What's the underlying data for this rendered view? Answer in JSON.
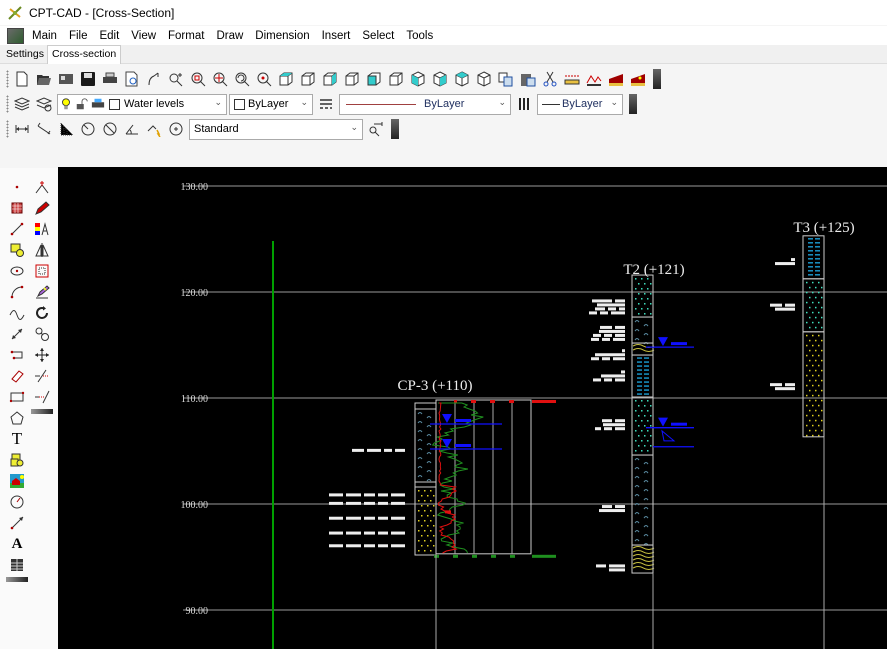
{
  "window": {
    "title": "CPT-CAD - [Cross-Section]",
    "app_icon": "cptcad-logo-icon"
  },
  "menubar": {
    "items": [
      "Main",
      "File",
      "Edit",
      "View",
      "Format",
      "Draw",
      "Dimension",
      "Insert",
      "Select",
      "Tools"
    ]
  },
  "tabs": [
    {
      "label": "Settings",
      "active": false
    },
    {
      "label": "Cross-section",
      "active": true
    }
  ],
  "toolbar_standard": {
    "icons": [
      "new-icon",
      "open-icon",
      "import-icon",
      "save-icon",
      "print-icon",
      "print-preview-icon",
      "pan-realtime-icon",
      "zoom-realtime-icon",
      "zoom-window-icon",
      "zoom-pan-icon",
      "zoom-previous-icon",
      "zoom-center-icon",
      "view-top-icon",
      "view-bottom-icon",
      "view-left-icon",
      "view-right-icon",
      "view-front-icon",
      "view-back-icon",
      "iso-sw-icon",
      "iso-se-icon",
      "iso-ne-icon",
      "iso-nw-icon",
      "copy-icon",
      "paste-icon",
      "cut-icon",
      "ruler-icon",
      "profile-icon",
      "section-icon",
      "section-marker-icon"
    ]
  },
  "toolbar_layers": {
    "layer_value": "Water levels",
    "color_value": "ByLayer",
    "linetype_value": "ByLayer",
    "lineweight_value": "ByLayer"
  },
  "toolbar_dimension": {
    "style_value": "Standard"
  },
  "left_toolbar": {
    "col1": [
      "point-icon",
      "hatch-icon",
      "line-icon",
      "region-icon",
      "ellipse-icon",
      "arc-icon",
      "spline-icon",
      "dimension-line-icon",
      "polyline-icon",
      "eraser-icon",
      "rectangle-icon",
      "polygon-icon",
      "text-icon",
      "block-icon",
      "image-icon",
      "circle-tool-icon",
      "ray-icon",
      "mtext-icon",
      "table-icon"
    ],
    "col2": [
      "snap-icon",
      "pencil-icon",
      "layer-colors-icon",
      "mirror-icon",
      "offset-icon",
      "edit-text-icon",
      "rotate-icon",
      "scale-icon",
      "move-icon",
      "trim-icon",
      "extend-icon"
    ]
  },
  "canvas": {
    "elevation_labels": [
      "130.00",
      "120.00",
      "110.00",
      "100.00",
      "90.00"
    ],
    "boreholes": [
      {
        "name": "CP-3 (+110)"
      },
      {
        "name": "T2 (+121)"
      },
      {
        "name": "T3 (+125)"
      }
    ],
    "colors": {
      "background": "#000000",
      "gridline": "#9a9a9a",
      "reference_line": "#00a000",
      "cone_resistance": "#1f8f1f",
      "friction_ratio": "#e01010",
      "water_level": "#1010ff",
      "clay": "#1b9fd6",
      "sand": "#e0d020",
      "gravel": "#40e0c0"
    }
  }
}
